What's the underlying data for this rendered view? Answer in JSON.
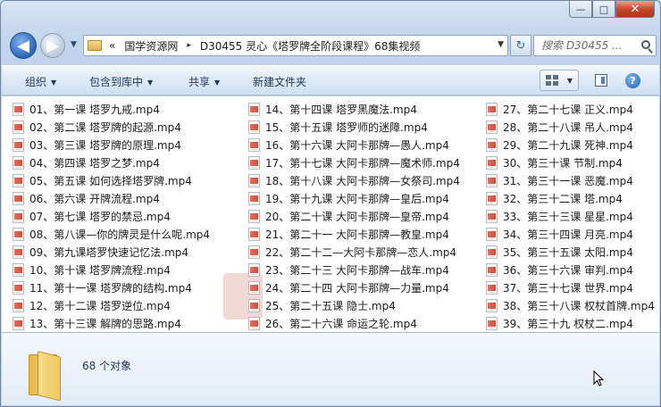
{
  "window": {
    "caption": {
      "minimize": "—",
      "maximize": "□",
      "close": "✕"
    }
  },
  "nav": {
    "back_icon": "◀",
    "forward_icon": "▶",
    "dropdown_icon": "▼",
    "breadcrumb": [
      "«",
      "国学资源网",
      "▸",
      "D30455 灵心《塔罗牌全阶段课程》68集视频"
    ],
    "refresh_icon": "↻",
    "search_placeholder": "搜索 D30455 ..."
  },
  "toolbar": {
    "organize": "组织",
    "include_in_library": "包含到库中",
    "share": "共享",
    "new_folder": "新建文件夹",
    "help_icon": "?"
  },
  "files": {
    "col1": [
      "01、第一课 塔罗九戒.mp4",
      "02、第二课 塔罗牌的起源.mp4",
      "03、第三课 塔罗牌的原理.mp4",
      "04、第四课 塔罗之梦.mp4",
      "05、第五课 如何选择塔罗牌.mp4",
      "06、第六课 开牌流程.mp4",
      "07、第七课 塔罗的禁忌.mp4",
      "08、第八课—你的牌灵是什么呢.mp4",
      "09、第九课塔罗快速记忆法.mp4",
      "10、第十课 塔罗牌流程.mp4",
      "11、第十一课 塔罗牌的结构.mp4",
      "12、第十二课 塔罗逆位.mp4",
      "13、第十三课 解牌的思路.mp4"
    ],
    "col2": [
      "14、第十四课 塔罗黑魔法.mp4",
      "15、第十五课 塔罗师的迷障.mp4",
      "16、第十六课 大阿卡那牌—愚人.mp4",
      "17、第十七课 大阿卡那牌—魔术师.mp4",
      "18、第十八课 大阿卡那牌—女祭司.mp4",
      "19、第十九课 大阿卡那牌—皇后.mp4",
      "20、第二十课 大阿卡那牌—皇帝.mp4",
      "21、第二十一 大阿卡那牌—教皇.mp4",
      "22、第二十二—大阿卡那牌—恋人.mp4",
      "23、第二十三 大阿卡那牌—战车.mp4",
      "24、第二十四 大阿卡那牌—力量.mp4",
      "25、第二十五课 隐士.mp4",
      "26、第二十六课 命运之轮.mp4"
    ],
    "col3": [
      "27、第二十七课 正义.mp4",
      "28、第二十八课 吊人.mp4",
      "29、第二十九课 死神.mp4",
      "30、第三十课 节制.mp4",
      "31、第三十一课 恶魔.mp4",
      "32、第三十二课 塔.mp4",
      "33、第三十三课 星星.mp4",
      "34、第三十四课 月亮.mp4",
      "35、第三十五课 太阳.mp4",
      "36、第三十六课 审判.mp4",
      "37、第三十七课 世界.mp4",
      "38、第三十八课 权杖首牌.mp4",
      "39、第三十九 权杖二.mp4"
    ]
  },
  "details": {
    "count": "68 个对象"
  }
}
